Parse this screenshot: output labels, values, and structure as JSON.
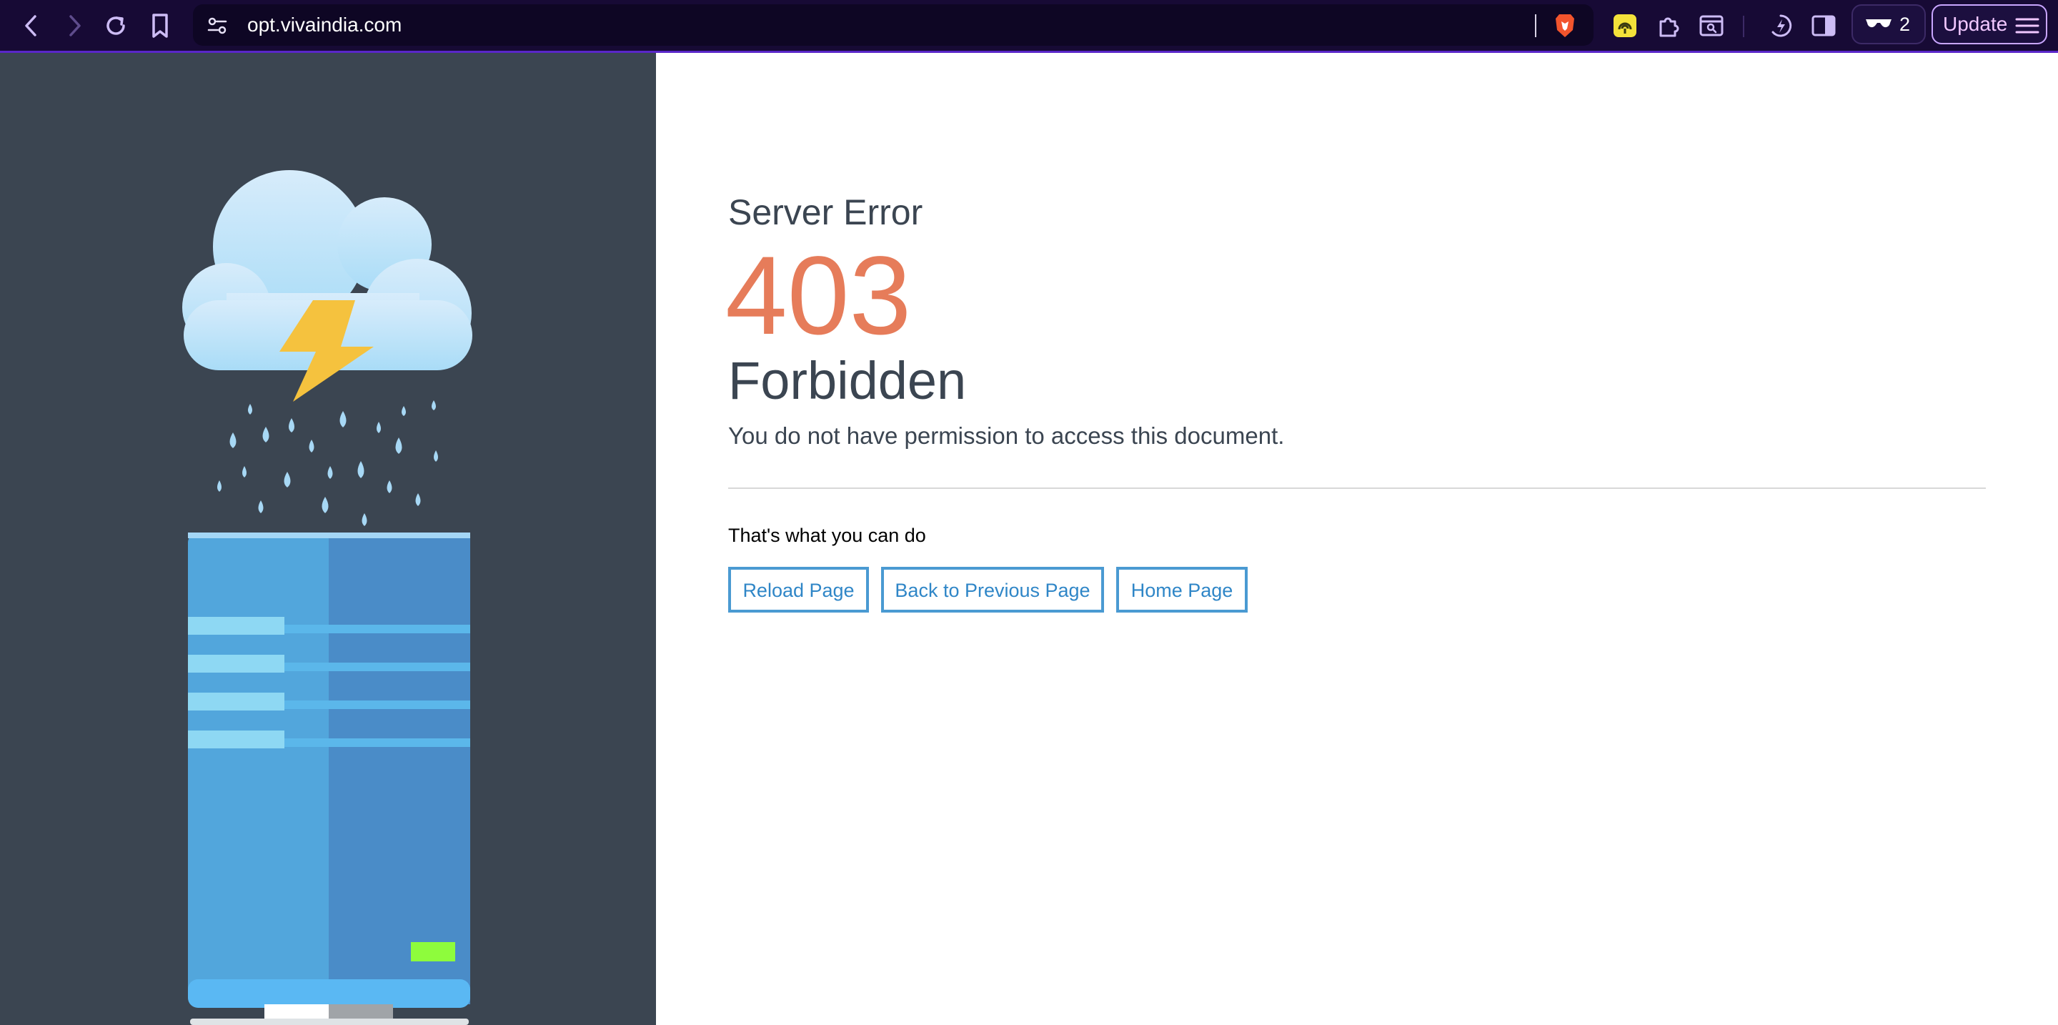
{
  "browser": {
    "url": "opt.vivaindia.com",
    "tab_count": "2",
    "update_label": "Update",
    "accent": "#5a26c9",
    "toolbar_bg": "#170a35",
    "icons": [
      "back-icon",
      "forward-icon",
      "reload-icon",
      "bookmark-icon",
      "site-settings-icon",
      "brave-shields-icon",
      "extension-audio-icon",
      "extensions-icon",
      "search-tab-icon",
      "leo-ai-icon",
      "sidebar-icon",
      "private-glasses-icon",
      "menu-icon"
    ]
  },
  "page": {
    "server_error": "Server Error",
    "code": "403",
    "status": "Forbidden",
    "message": "You do not have permission to access this document.",
    "actions_heading": "That's what you can do",
    "buttons": {
      "reload": "Reload Page",
      "back": "Back to Previous Page",
      "home": "Home Page"
    },
    "colors": {
      "code": "#e67c5a",
      "text": "#3b4551",
      "button": "#2f86c7",
      "panel": "#3b4551"
    }
  },
  "illustration": {
    "icons": [
      "cloud-icon",
      "lightning-icon",
      "rain-icon",
      "server-icon"
    ]
  }
}
